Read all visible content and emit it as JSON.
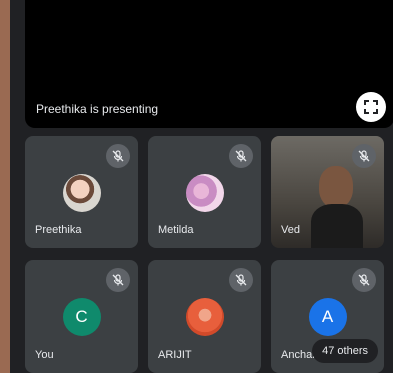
{
  "presentation": {
    "label": "Preethika is presenting",
    "fullscreen_icon": "fullscreen-icon"
  },
  "tiles": [
    {
      "name": "Preethika",
      "avatar_type": "photo",
      "muted": true
    },
    {
      "name": "Metilda",
      "avatar_type": "photo",
      "muted": true
    },
    {
      "name": "Ved",
      "avatar_type": "video",
      "muted": true
    },
    {
      "name": "You",
      "avatar_letter": "C",
      "avatar_color": "#0f8a6c",
      "muted": true
    },
    {
      "name": "ARIJIT",
      "avatar_type": "photo",
      "muted": true
    },
    {
      "name": "Anchal",
      "avatar_letter": "A",
      "avatar_color": "#1a73e8",
      "muted": true
    }
  ],
  "overflow": {
    "others_label": "47 others"
  },
  "colors": {
    "tile_bg": "#3c4043",
    "stage_bg": "#202124",
    "mute_badge": "#5f6368"
  }
}
